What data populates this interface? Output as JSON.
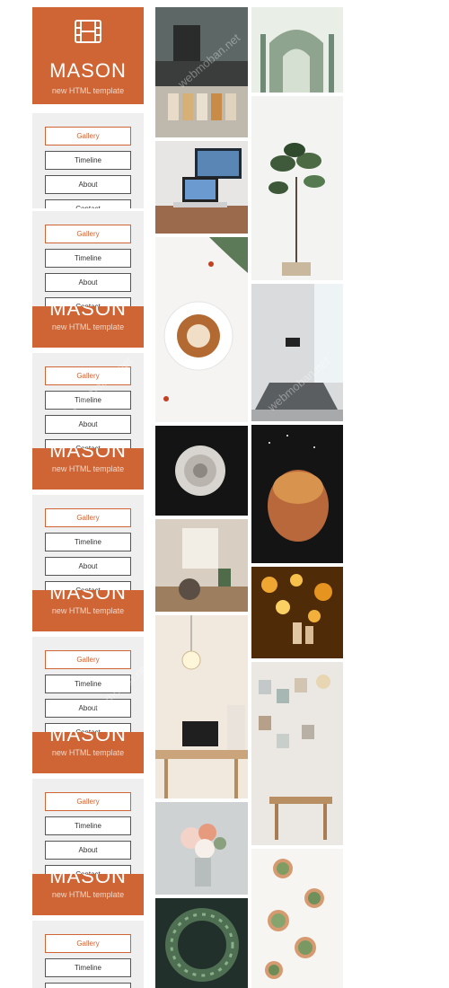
{
  "brand": {
    "title": "MASON",
    "subtitle": "new HTML template"
  },
  "nav": {
    "gallery": "Gallery",
    "timeline": "Timeline",
    "about": "About",
    "contact": "Contact"
  },
  "watermark": "webmoban.net",
  "gallery_images": [
    "coffee-bar-jars-image",
    "building-facade-drawing-image",
    "desk-laptop-monitor-image",
    "fiddle-leaf-plant-image",
    "latte-art-cup-image",
    "conference-room-image",
    "white-rose-image",
    "bread-loaf-image",
    "sunlit-living-room-image",
    "bokeh-figurines-image",
    "pendant-lamp-desk-image",
    "photo-wall-dining-image",
    "flower-bouquet-image",
    "succulents-pots-image",
    "wreath-greenery-image"
  ]
}
